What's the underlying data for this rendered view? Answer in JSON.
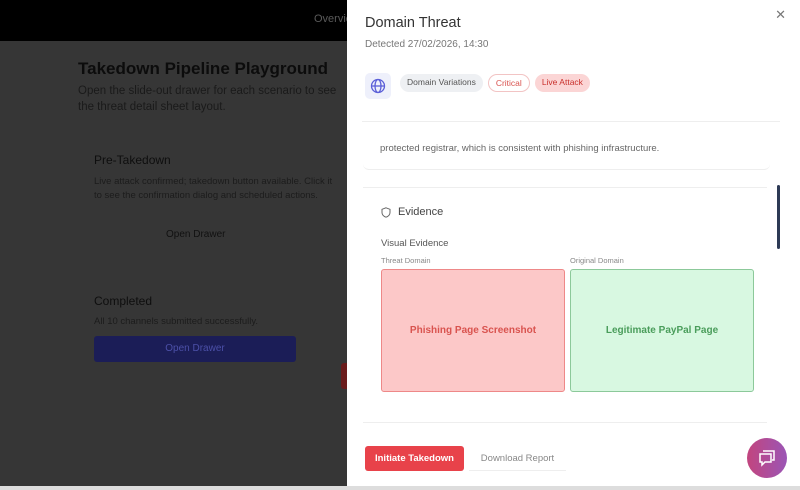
{
  "background": {
    "nav_item": "Overview",
    "title": "Takedown Pipeline Playground",
    "subtitle": "Open the slide-out drawer for each scenario to see the threat detail sheet layout.",
    "cards": [
      {
        "title": "Pre-Takedown",
        "desc": "Live attack confirmed; takedown button available. Click it to see the confirmation dialog and scheduled actions.",
        "button": "Open Drawer"
      },
      {
        "title": "Completed",
        "desc": "All 10 channels submitted successfully.",
        "button": "Open Drawer"
      }
    ]
  },
  "drawer": {
    "title": "Domain Threat",
    "detected": "Detected 27/02/2026, 14:30",
    "icon": "globe-icon",
    "badges": [
      "Domain Variations",
      "Critical",
      "Live Attack"
    ],
    "summary_text": "protected registrar, which is consistent with phishing infrastructure.",
    "evidence": {
      "heading": "Evidence",
      "visual_label": "Visual Evidence",
      "threat_label": "Threat Domain",
      "original_label": "Original Domain",
      "threat_shot": "Phishing Page Screenshot",
      "original_shot": "Legitimate PayPal Page"
    },
    "actions": {
      "initiate": "Initiate Takedown",
      "download": "Download Report"
    }
  },
  "colors": {
    "danger": "#e8424a",
    "accent": "#2b2fa8",
    "fab": "#b04c98"
  }
}
